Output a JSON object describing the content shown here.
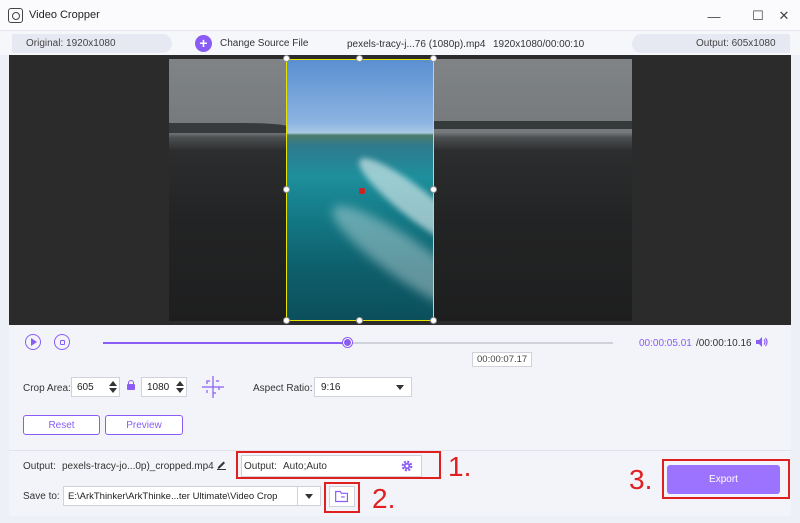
{
  "window": {
    "title": "Video Cropper",
    "minimize": "—",
    "maximize": "☐",
    "close": "✕"
  },
  "infobar": {
    "original": "Original: 1920x1080",
    "change_source": "Change Source File",
    "file_name": "pexels-tracy-j...76 (1080p).mp4",
    "file_meta": "1920x1080/00:00:10",
    "output": "Output: 605x1080"
  },
  "playback": {
    "progress": 0.48,
    "current_time": "00:00:05.01",
    "total_time": "/00:00:10.16",
    "tooltip": "00:00:07.17"
  },
  "crop": {
    "label": "Crop Area:",
    "width": "605",
    "height": "1080",
    "aspect_label": "Aspect Ratio:",
    "aspect_value": "9:16",
    "reset": "Reset",
    "preview": "Preview"
  },
  "output": {
    "label": "Output:",
    "file_name": "pexels-tracy-jo...0p)_cropped.mp4",
    "settings_label": "Output:",
    "settings_value": "Auto;Auto",
    "save_label": "Save to:",
    "save_path": "E:\\ArkThinker\\ArkThinke...ter Ultimate\\Video Crop",
    "export": "Export"
  },
  "annotations": [
    "1.",
    "2.",
    "3."
  ],
  "colors": {
    "accent": "#8a5cf6",
    "annotation": "#e02020",
    "crop_border": "#e8e400"
  }
}
